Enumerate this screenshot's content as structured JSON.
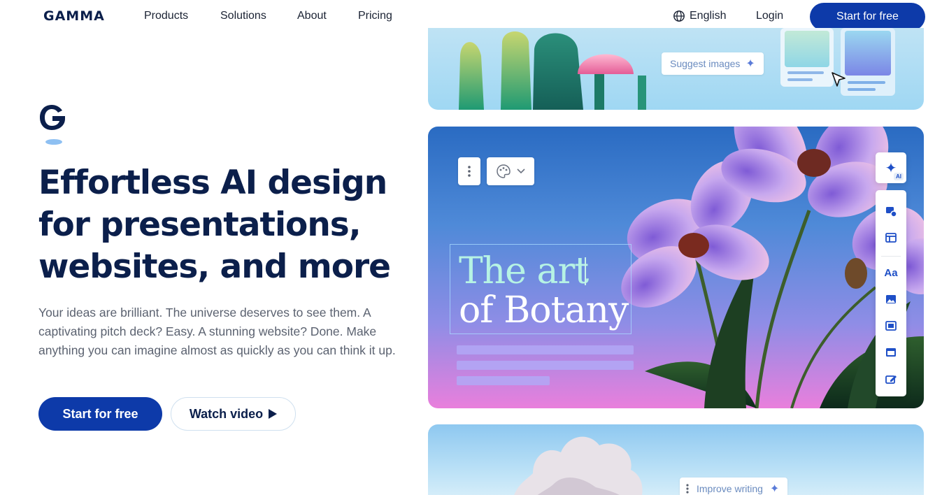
{
  "nav": {
    "logo": "GAMMA",
    "links": [
      "Products",
      "Solutions",
      "About",
      "Pricing"
    ],
    "language": "English",
    "login": "Login",
    "cta": "Start for free"
  },
  "hero": {
    "headline_lines": [
      "Effortless AI design",
      "for presentations,",
      "websites, and more"
    ],
    "subcopy": "Your ideas are brilliant. The universe deserves to see them. A captivating pitch deck? Easy. A stunning website? Done. Make anything you can imagine almost as quickly as you can think it up.",
    "primary_cta": "Start for free",
    "secondary_cta": "Watch video"
  },
  "preview": {
    "suggest_images": "Suggest images",
    "improve_writing": "Improve writing",
    "slide_title_lines": [
      "The art",
      "of Botany"
    ],
    "ai_badge": "AI",
    "toolbar_icons": [
      "cards-add-icon",
      "layout-icon",
      "text-icon",
      "image-icon",
      "video-icon",
      "embed-icon",
      "edit-icon"
    ]
  },
  "colors": {
    "brand": "#0d3aa9",
    "text": "#0b1f4b",
    "accent_icon": "#1e4fc7"
  }
}
